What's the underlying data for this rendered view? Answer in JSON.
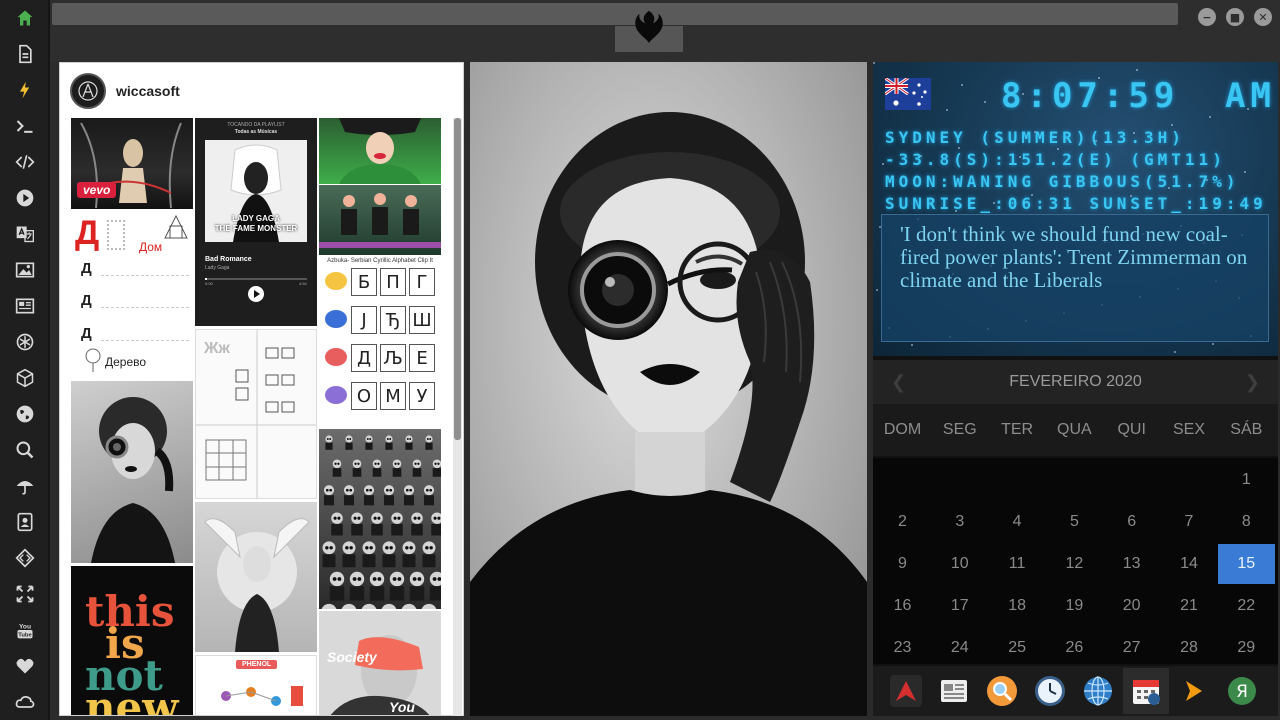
{
  "sidebar": {
    "items": [
      {
        "icon": "home-icon",
        "color": "#4caf50"
      },
      {
        "icon": "document-icon",
        "color": "#d8d8d8"
      },
      {
        "icon": "lightning-icon",
        "color": "#f0c030"
      },
      {
        "icon": "terminal-icon",
        "color": "#d8d8d8"
      },
      {
        "icon": "code-icon",
        "color": "#d8d8d8"
      },
      {
        "icon": "play-icon",
        "color": "#d8d8d8"
      },
      {
        "icon": "translate-icon",
        "color": "#d8d8d8"
      },
      {
        "icon": "image-icon",
        "color": "#d8d8d8"
      },
      {
        "icon": "news-icon",
        "color": "#d8d8d8"
      },
      {
        "icon": "openai-icon",
        "color": "#d8d8d8"
      },
      {
        "icon": "cube-icon",
        "color": "#d8d8d8"
      },
      {
        "icon": "globe-icon",
        "color": "#d8d8d8"
      },
      {
        "icon": "search-icon",
        "color": "#d8d8d8"
      },
      {
        "icon": "umbrella-icon",
        "color": "#d8d8d8"
      },
      {
        "icon": "contacts-icon",
        "color": "#d8d8d8"
      },
      {
        "icon": "diamond-code-icon",
        "color": "#d8d8d8"
      },
      {
        "icon": "expand-icon",
        "color": "#d8d8d8"
      },
      {
        "icon": "youtube-icon",
        "color": "#d8d8d8"
      },
      {
        "icon": "heart-icon",
        "color": "#d8d8d8"
      },
      {
        "icon": "cloud-icon",
        "color": "#d8d8d8"
      }
    ]
  },
  "topbar": {
    "logo_icon": "rebel-alliance-icon",
    "window_controls": [
      "minimize-icon",
      "maximize-icon",
      "close-icon"
    ]
  },
  "pinterest": {
    "username": "wiccasoft",
    "pins": [
      {
        "name": "pin-lady-gaga-vevo",
        "badge": "vevo"
      },
      {
        "name": "pin-spotify-playlist",
        "playlist_header": "TOCANDO DA PLAYLIST",
        "playlist_name": "Todas as Músicas",
        "cover_text": "LADY GAGA\nTHE FAME MONSTER",
        "song": "Bad Romance",
        "artist": "Lady Gaga",
        "time_elapsed": "0:00",
        "time_total": "4:54"
      },
      {
        "name": "pin-green-jacket"
      },
      {
        "name": "pin-three-dancers"
      },
      {
        "name": "pin-cyrillic-handwriting",
        "big_letter": "Д",
        "word1": "Дом",
        "line_letter": "Д",
        "word2": "Дерево"
      },
      {
        "name": "pin-cyrillic-alphabet",
        "title": "Azbuka- Serbian Cyrillic Alphabet Clip It",
        "letters": [
          "Б",
          "П",
          "Г",
          "Ј",
          "Ђ",
          "Ш",
          "Д",
          "Љ",
          "Е",
          "О",
          "М",
          "У"
        ]
      },
      {
        "name": "pin-worksheet",
        "letters": "Жж"
      },
      {
        "name": "pin-monocle-woman"
      },
      {
        "name": "pin-winged-head"
      },
      {
        "name": "pin-masked-crowd"
      },
      {
        "name": "pin-this-is-not-new",
        "text": [
          "this",
          "is",
          "not",
          "new"
        ]
      },
      {
        "name": "pin-phenol-chart",
        "title": "PHENOL"
      },
      {
        "name": "pin-society-you",
        "text1": "Society",
        "text2": "You"
      }
    ]
  },
  "clock": {
    "country_flag": "australia-flag-icon",
    "time": "8:07:59",
    "ampm": "AM",
    "location": "SYDNEY (SUMMER)(13.3H)",
    "coords": "-33.8(S):151.2(E) (GMT11)",
    "moon": "MOON:WANING GIBBOUS(51.7%)",
    "sun": "SUNRISE_:06:31 SUNSET_:19:49",
    "news": "'I don't think we should fund new coal-fired power plants': Trent Zimmerman on climate and the Liberals"
  },
  "calendar": {
    "title": "FEVEREIRO 2020",
    "prev_icon": "chevron-left-icon",
    "next_icon": "chevron-right-icon",
    "day_names": [
      "DOM",
      "SEG",
      "TER",
      "QUA",
      "QUI",
      "SEX",
      "SÁB"
    ],
    "weeks": [
      [
        "",
        "",
        "",
        "",
        "",
        "",
        "1"
      ],
      [
        "2",
        "3",
        "4",
        "5",
        "6",
        "7",
        "8"
      ],
      [
        "9",
        "10",
        "11",
        "12",
        "13",
        "14",
        "15"
      ],
      [
        "16",
        "17",
        "18",
        "19",
        "20",
        "21",
        "22"
      ],
      [
        "23",
        "24",
        "25",
        "26",
        "27",
        "28",
        "29"
      ]
    ],
    "selected": "15",
    "accent": "#3a7bd5"
  },
  "dock": {
    "apps": [
      "arch-icon",
      "news-reader-icon",
      "search-magnifier-icon",
      "clock-icon",
      "globe-icon",
      "calendar-icon",
      "arrow-play-icon",
      "yandex-icon"
    ]
  }
}
